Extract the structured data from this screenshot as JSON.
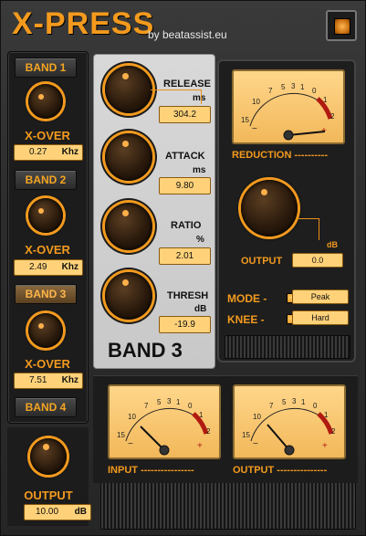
{
  "header": {
    "title": "X-PRESS",
    "byline": "by beatassist.eu"
  },
  "bands": [
    {
      "label": "BAND 1",
      "xover_label": "X-OVER",
      "xover_value": "0.27",
      "xover_unit": "Khz"
    },
    {
      "label": "BAND 2",
      "xover_label": "X-OVER",
      "xover_value": "2.49",
      "xover_unit": "Khz"
    },
    {
      "label": "BAND 3",
      "xover_label": "X-OVER",
      "xover_value": "7.51",
      "xover_unit": "Khz"
    },
    {
      "label": "BAND 4"
    }
  ],
  "selected_band": "BAND 3",
  "params": {
    "release": {
      "label": "RELEASE",
      "unit": "ms",
      "value": "304.2"
    },
    "attack": {
      "label": "ATTACK",
      "unit": "ms",
      "value": "9.80"
    },
    "ratio": {
      "label": "RATIO",
      "unit": "%",
      "value": "2.01"
    },
    "thresh": {
      "label": "THRESH",
      "unit": "dB",
      "value": "-19.9"
    }
  },
  "band_title": "BAND 3",
  "reduction": {
    "label": "REDUCTION",
    "dashes": "----------",
    "scale": [
      "15",
      "10",
      "7",
      "5",
      "3",
      "1",
      "0",
      "1",
      "2"
    ],
    "minus": "−",
    "plus": "+"
  },
  "output_band": {
    "label": "OUTPUT",
    "unit": "dB",
    "value": "0.0"
  },
  "mode": {
    "label": "MODE -",
    "value": "Peak"
  },
  "knee": {
    "label": "KNEE -",
    "value": "Hard"
  },
  "input_meter": {
    "label": "INPUT",
    "dashes": "----------------"
  },
  "output_meter": {
    "label": "OUTPUT",
    "dashes": "---------------"
  },
  "master_output": {
    "label": "OUTPUT",
    "value": "10.00",
    "unit": "dB"
  },
  "colors": {
    "accent": "#f39a1e",
    "field_bg": "#ffd27a",
    "panel_light": "#d0d0d0"
  }
}
